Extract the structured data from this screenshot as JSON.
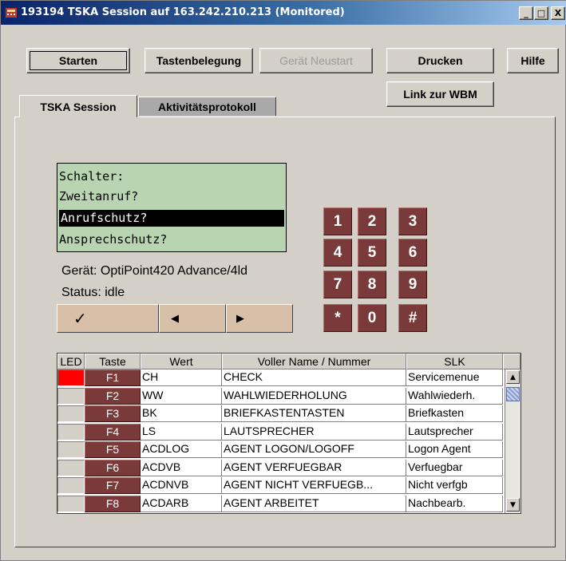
{
  "window": {
    "title": "193194 TSKA Session auf 163.242.210.213 (Monitored)"
  },
  "titlebar_buttons": {
    "minimize": "_",
    "maximize": "□",
    "close": "X"
  },
  "toolbar": {
    "start": "Starten",
    "keymap": "Tastenbelegung",
    "restart": "Gerät Neustart",
    "print": "Drucken",
    "help": "Hilfe",
    "wbm_link": "Link zur WBM"
  },
  "tabs": [
    {
      "label": "TSKA Session",
      "active": true
    },
    {
      "label": "Aktivitätsprotokoll",
      "active": false
    }
  ],
  "display": {
    "lines": [
      "Schalter:",
      "Zweitanruf?",
      "Anrufschutz?",
      "Ansprechschutz?"
    ],
    "selected_index": 2
  },
  "device": {
    "model": "Gerät: OptiPoint420 Advance/4ld",
    "status": "Status: idle"
  },
  "nav_buttons": {
    "ok": "✓",
    "left": "◀",
    "right": "▶"
  },
  "keypad": [
    "1",
    "2",
    "3",
    "4",
    "5",
    "6",
    "7",
    "8",
    "9",
    "*",
    "0",
    "#"
  ],
  "table": {
    "columns": [
      "LED",
      "Taste",
      "Wert",
      "Voller Name / Nummer",
      "SLK"
    ],
    "rows": [
      {
        "led": true,
        "key": "F1",
        "value": "CH",
        "fullname": "CHECK",
        "slk": "Servicemenue"
      },
      {
        "led": false,
        "key": "F2",
        "value": "WW",
        "fullname": "WAHLWIEDERHOLUNG",
        "slk": "Wahlwiederh."
      },
      {
        "led": false,
        "key": "F3",
        "value": "BK",
        "fullname": "BRIEFKASTENTASTEN",
        "slk": "Briefkasten"
      },
      {
        "led": false,
        "key": "F4",
        "value": "LS",
        "fullname": "LAUTSPRECHER",
        "slk": "Lautsprecher"
      },
      {
        "led": false,
        "key": "F5",
        "value": "ACDLOG",
        "fullname": "AGENT LOGON/LOGOFF",
        "slk": "Logon Agent"
      },
      {
        "led": false,
        "key": "F6",
        "value": "ACDVB",
        "fullname": "AGENT VERFUEGBAR",
        "slk": "Verfuegbar"
      },
      {
        "led": false,
        "key": "F7",
        "value": "ACDNVB",
        "fullname": "AGENT NICHT VERFUEGB...",
        "slk": "Nicht verfgb"
      },
      {
        "led": false,
        "key": "F8",
        "value": "ACDARB",
        "fullname": "AGENT ARBEITET",
        "slk": "Nachbearb."
      }
    ]
  },
  "colors": {
    "window_bg": "#d4d0c8",
    "lcd_bg": "#b8d4b0",
    "key_bg": "#7a3a3a",
    "led_on": "#ff0000",
    "nav_bg": "#d8bfa8"
  },
  "icons": {
    "app": "phone-app-icon"
  }
}
